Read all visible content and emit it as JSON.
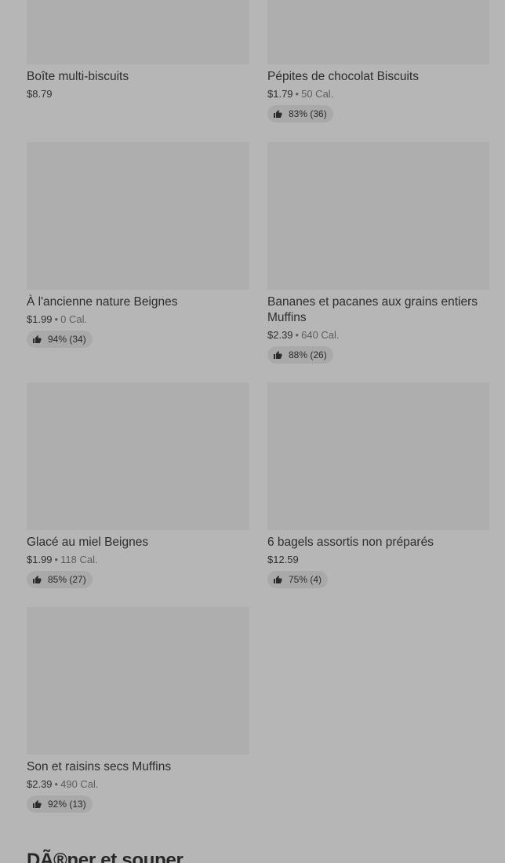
{
  "items": [
    {
      "name": "Boîte multi-biscuits",
      "price": "$8.79"
    },
    {
      "name": "Pépites de chocolat Biscuits",
      "price": "$1.79",
      "calories": "50 Cal.",
      "rating": "83% (36)"
    },
    {
      "name": "À l'ancienne nature Beignes",
      "price": "$1.99",
      "calories": "0 Cal.",
      "rating": "94% (34)"
    },
    {
      "name": "Bananes et pacanes aux grains entiers Muffins",
      "price": "$2.39",
      "calories": "640 Cal.",
      "rating": "88% (26)"
    },
    {
      "name": "Glacé au miel Beignes",
      "price": "$1.99",
      "calories": "118 Cal.",
      "rating": "85% (27)"
    },
    {
      "name": "6 bagels assortis non préparés",
      "price": "$12.59",
      "rating": "75% (4)"
    },
    {
      "name": "Son et raisins secs Muffins",
      "price": "$2.39",
      "calories": "490 Cal.",
      "rating": "92% (13)"
    }
  ],
  "separator": "•",
  "next_section_title": "DÃ®ner et souper"
}
